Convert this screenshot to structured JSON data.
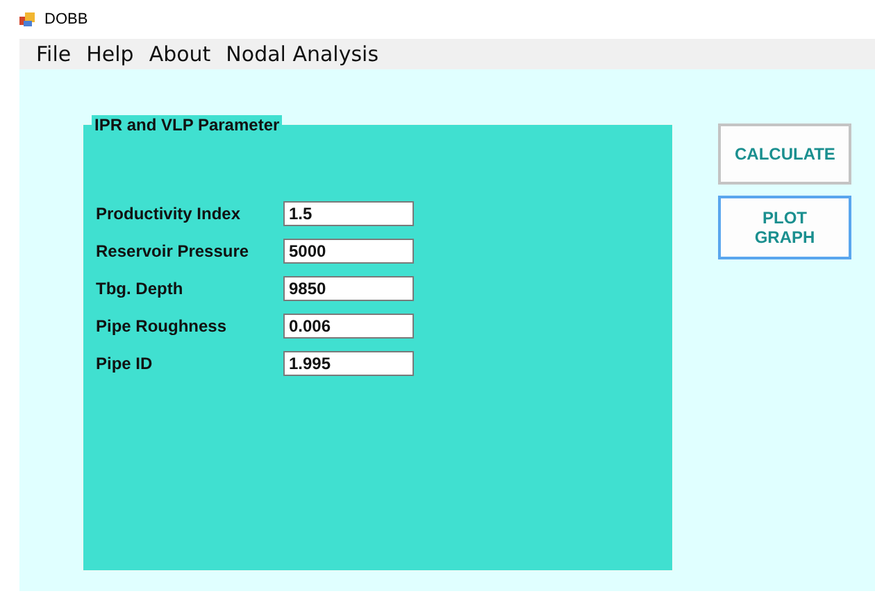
{
  "window": {
    "title": "DOBB"
  },
  "menu": [
    "File",
    "Help",
    "About",
    "Nodal Analysis"
  ],
  "group": {
    "title": "IPR and VLP Parameter",
    "fields": [
      {
        "label": "Productivity Index",
        "value": "1.5"
      },
      {
        "label": "Reservoir Pressure",
        "value": "5000"
      },
      {
        "label": "Tbg. Depth",
        "value": "9850"
      },
      {
        "label": "Pipe Roughness",
        "value": "0.006"
      },
      {
        "label": "Pipe ID",
        "value": "1.995"
      }
    ]
  },
  "buttons": [
    {
      "label": "CALCULATE",
      "focused": false
    },
    {
      "label": "PLOT GRAPH",
      "focused": true
    }
  ]
}
